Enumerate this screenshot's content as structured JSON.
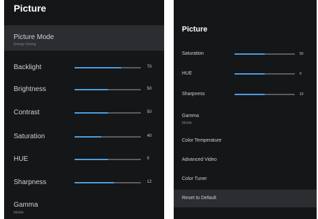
{
  "left_panel": {
    "title": "Picture",
    "picture_mode": {
      "label": "Picture Mode",
      "value": "Energy Saving"
    },
    "sliders": [
      {
        "label": "Backlight",
        "value": "70",
        "level": 70
      },
      {
        "label": "Brightness",
        "value": "50",
        "level": 50
      },
      {
        "label": "Contrast",
        "value": "50",
        "level": 50
      },
      {
        "label": "Saturation",
        "value": "40",
        "level": 40
      },
      {
        "label": "HUE",
        "value": "0",
        "level": 50
      },
      {
        "label": "Sharpness",
        "value": "12",
        "level": 60
      }
    ],
    "gamma": {
      "label": "Gamma",
      "value": "Middle"
    }
  },
  "right_panel": {
    "title": "Picture",
    "sliders": [
      {
        "label": "Saturation",
        "value": "50",
        "level": 50
      },
      {
        "label": "HUE",
        "value": "0",
        "level": 50
      },
      {
        "label": "Sharpness",
        "value": "10",
        "level": 50
      }
    ],
    "gamma": {
      "label": "Gamma",
      "value": "Middle"
    },
    "items": [
      "Color Temperature",
      "Advanced Video",
      "Color Tuner",
      "Reset to Default"
    ]
  },
  "colors": {
    "background": "#151618",
    "highlight": "#2b2d31",
    "accent": "#4aa0e6",
    "track": "#5a5d63"
  }
}
